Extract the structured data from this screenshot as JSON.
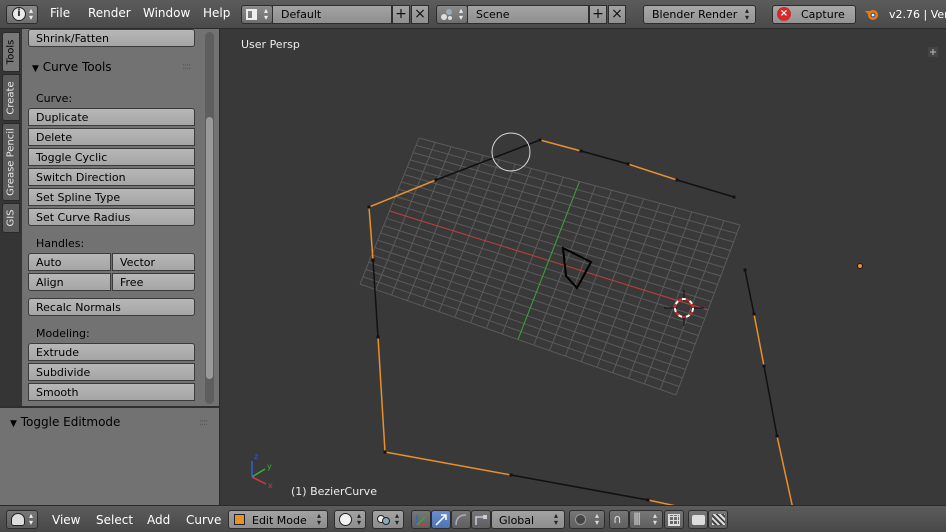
{
  "topbar": {
    "menus": [
      "File",
      "Render",
      "Window",
      "Help"
    ],
    "screen_layout": "Default",
    "scene": "Scene",
    "render_engine": "Blender Render",
    "capture_label": "Capture",
    "version": "v2.76 | Ver"
  },
  "tabs": [
    "Tools",
    "Create",
    "Grease Pencil",
    "GIS"
  ],
  "shelf": {
    "top_button": "Shrink/Fatten",
    "panel_title": "Curve Tools",
    "curve_label": "Curve:",
    "curve_buttons": [
      "Duplicate",
      "Delete",
      "Toggle Cyclic",
      "Switch Direction",
      "Set Spline Type",
      "Set Curve Radius"
    ],
    "handles_label": "Handles:",
    "handles": [
      [
        "Auto",
        "Vector"
      ],
      [
        "Align",
        "Free"
      ]
    ],
    "recalc": "Recalc Normals",
    "modeling_label": "Modeling:",
    "modeling_buttons": [
      "Extrude",
      "Subdivide",
      "Smooth"
    ]
  },
  "operator_panel": {
    "title": "Toggle Editmode"
  },
  "viewport": {
    "view_label": "User Persp",
    "object_label": "(1) BezierCurve",
    "curve_color": "#e8902c",
    "grid_x_axis_color": "#c03a3a",
    "grid_y_axis_color": "#3aa03a"
  },
  "bottombar": {
    "menus": [
      "View",
      "Select",
      "Add",
      "Curve"
    ],
    "mode": "Edit Mode",
    "orientation": "Global"
  }
}
